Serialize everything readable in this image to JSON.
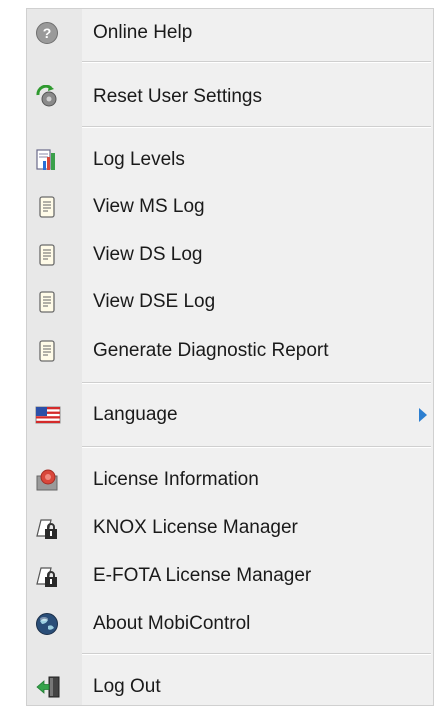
{
  "menu": {
    "help": {
      "label": "Online Help",
      "icon": "help-icon"
    },
    "reset": {
      "label": "Reset User Settings",
      "icon": "reset-settings-icon"
    },
    "log_levels": {
      "label": "Log Levels",
      "icon": "log-levels-icon"
    },
    "ms_log": {
      "label": "View MS Log",
      "icon": "log-document-icon"
    },
    "ds_log": {
      "label": "View DS Log",
      "icon": "log-document-icon"
    },
    "dse_log": {
      "label": "View DSE Log",
      "icon": "log-document-icon"
    },
    "diag": {
      "label": "Generate Diagnostic Report",
      "icon": "log-document-icon"
    },
    "language": {
      "label": "Language",
      "icon": "us-flag-icon",
      "has_submenu": true
    },
    "license_info": {
      "label": "License Information",
      "icon": "license-seal-icon"
    },
    "knox": {
      "label": "KNOX License Manager",
      "icon": "license-lock-icon"
    },
    "efota": {
      "label": "E-FOTA License Manager",
      "icon": "license-lock-icon"
    },
    "about": {
      "label": "About MobiControl",
      "icon": "globe-icon"
    },
    "logout": {
      "label": "Log Out",
      "icon": "logout-door-icon"
    }
  },
  "colors": {
    "menu_bg": "#f0f0f0",
    "gutter_bg": "#e8e8e8",
    "separator": "#cfcfcf",
    "submenu_arrow": "#2d7fd0"
  }
}
